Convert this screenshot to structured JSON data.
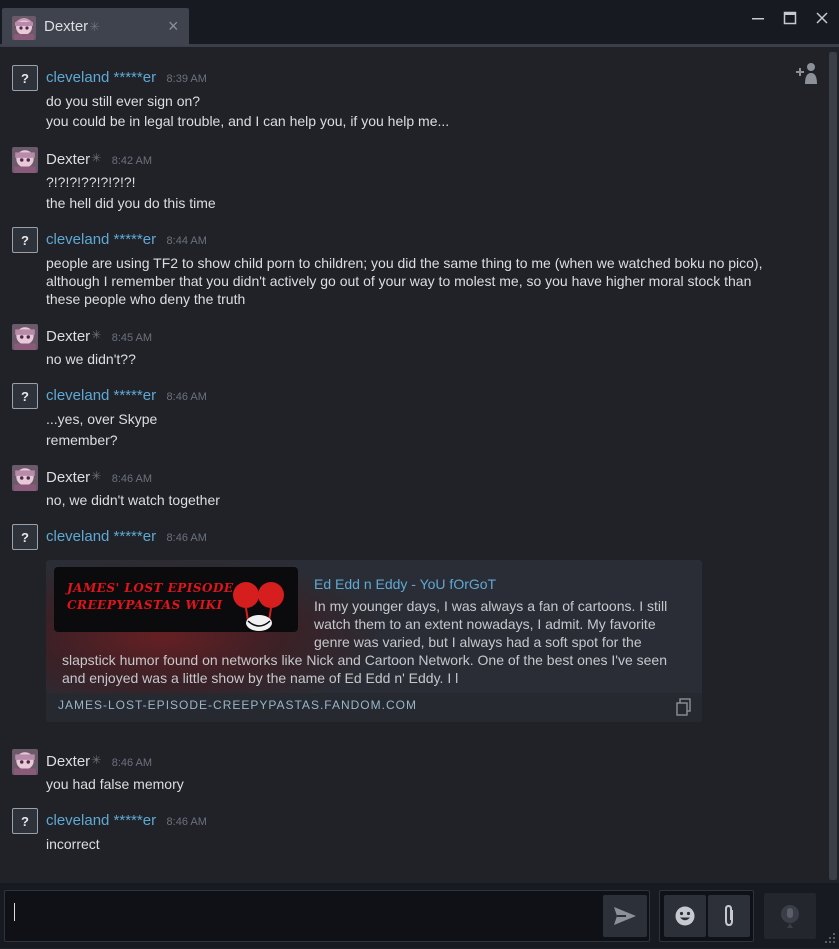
{
  "tab": {
    "title": "Dexter",
    "close_glyph": "×",
    "icons": {
      "avatar": "anime-avatar-icon",
      "close": "close-icon"
    }
  },
  "window_controls": [
    "minimize-icon",
    "maximize-icon",
    "close-icon"
  ],
  "header_icons": {
    "add_friend": "add-friend-icon"
  },
  "messages": [
    {
      "sender": "cleveland *****er",
      "time": "8:39 AM",
      "avatar": "question-mark-avatar",
      "lines": [
        "do you still ever sign on?",
        "you could be in legal trouble, and I can help you, if you help me..."
      ]
    },
    {
      "sender": "Dexter",
      "time": "8:42 AM",
      "avatar": "anime-avatar",
      "lines": [
        "?!?!?!??!?!?!?!",
        "the hell did you do this time"
      ]
    },
    {
      "sender": "cleveland *****er",
      "time": "8:44 AM",
      "avatar": "question-mark-avatar",
      "lines": [
        "people are using TF2 to show child porn to children; you did the same thing to me (when we watched boku no pico), although I remember that you didn't actively go out of your way to molest me, so you have higher moral stock than these people who deny the truth"
      ]
    },
    {
      "sender": "Dexter",
      "time": "8:45 AM",
      "avatar": "anime-avatar",
      "lines": [
        "no we didn't??"
      ]
    },
    {
      "sender": "cleveland *****er",
      "time": "8:46 AM",
      "avatar": "question-mark-avatar",
      "lines": [
        "...yes, over Skype",
        "remember?"
      ]
    },
    {
      "sender": "Dexter",
      "time": "8:46 AM",
      "avatar": "anime-avatar",
      "lines": [
        "no, we didn't watch together"
      ]
    },
    {
      "sender": "cleveland *****er",
      "time": "8:46 AM",
      "avatar": "question-mark-avatar",
      "lines": []
    },
    {
      "sender": "Dexter",
      "time": "8:46 AM",
      "avatar": "anime-avatar",
      "lines": [
        "you had false memory"
      ]
    },
    {
      "sender": "cleveland *****er",
      "time": "8:46 AM",
      "avatar": "question-mark-avatar",
      "lines": [
        "incorrect"
      ]
    }
  ],
  "embed": {
    "thumbnail_text_1": "JAMES' LOST EPISODE",
    "thumbnail_text_2": "CREEPYPASTAS WIKI",
    "title": "Ed Edd n Eddy - YoU fOrGoT",
    "description_1": "In my younger days, I was always a fan of cartoons. I still watch them to an extent nowadays, I admit. My favorite genre was varied, but I always had a soft spot for the",
    "description_2": "slapstick humor found on networks like Nick and Cartoon Network. One of the best ones I've seen and enjoyed was a little show by the name of Ed Edd n' Eddy. I l",
    "domain": "JAMES-LOST-EPISODE-CREEPYPASTAS.FANDOM.COM",
    "icons": {
      "copy": "copy-link-icon"
    }
  },
  "composer": {
    "placeholder": "",
    "icons": {
      "send": "send-icon",
      "emoji": "emoji-icon",
      "attach": "paperclip-icon",
      "voice": "microphone-icon"
    }
  },
  "colors": {
    "background": "#202228",
    "titlebar": "#171a21",
    "tab": "#3e434d",
    "link_blue": "#5ea9d4",
    "text": "#dcdedf",
    "muted": "#6b717c"
  }
}
